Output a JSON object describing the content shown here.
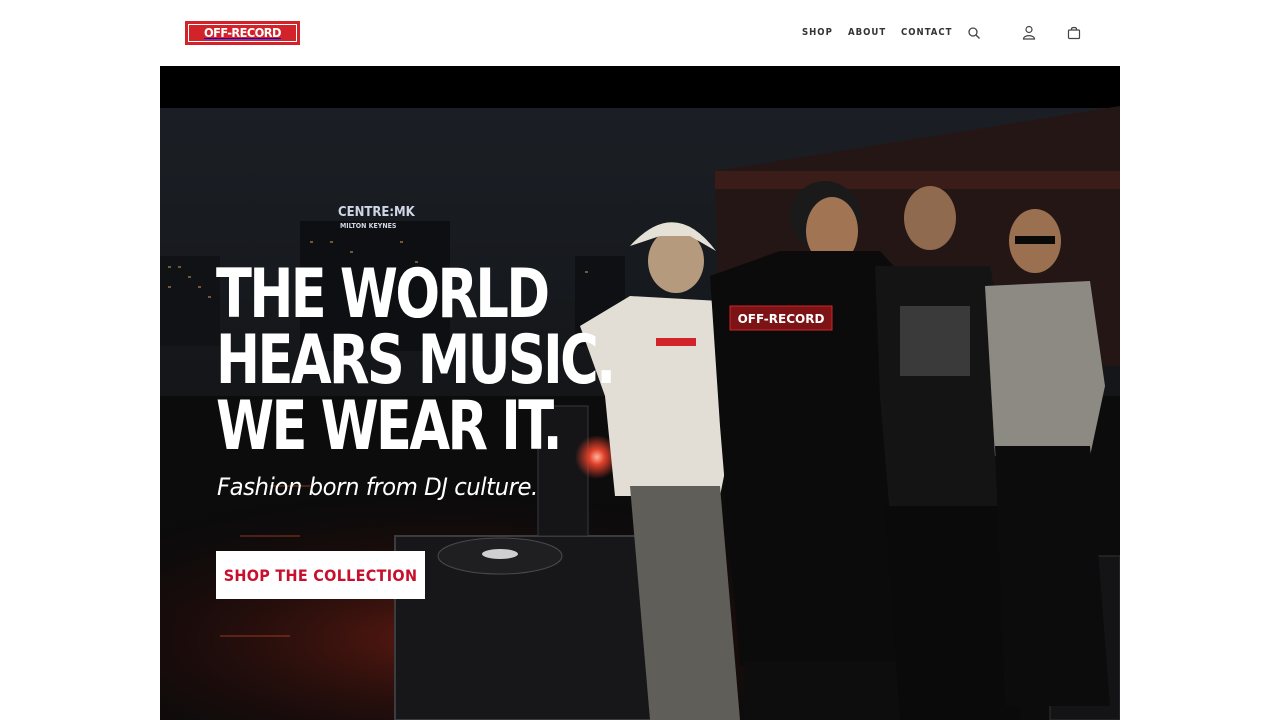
{
  "brand": {
    "logo_text": "OFF-RECORD",
    "accent": "#d2232a"
  },
  "nav": {
    "shop": "SHOP",
    "about": "ABOUT",
    "contact": "CONTACT",
    "icons": [
      "search-icon",
      "account-icon",
      "cart-icon"
    ]
  },
  "hero": {
    "headline_lines": [
      "THE WORLD",
      "HEARS MUSIC.",
      "WE WEAR IT."
    ],
    "subheadline": "Fashion born from DJ culture.",
    "cta_label": "SHOP THE COLLECTION",
    "image": {
      "sign_line1": "CENTRE:MK",
      "sign_line2": "MILTON KEYNES",
      "tshirt_print": "OFF-RECORD"
    }
  }
}
